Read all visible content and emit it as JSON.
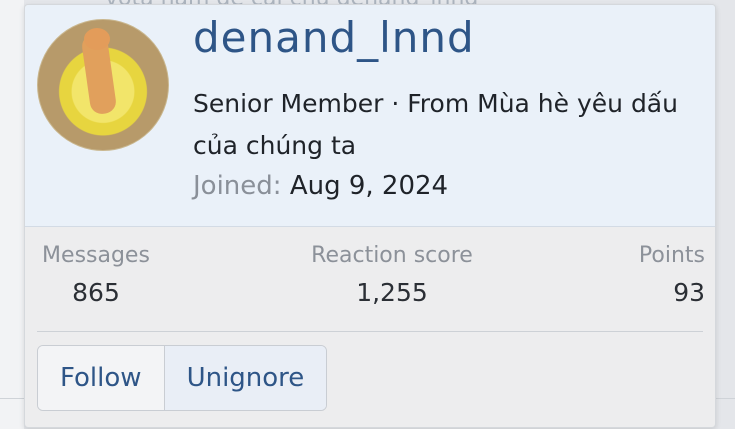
{
  "background": {
    "text": "vota ham de cai chu denand_lnnd"
  },
  "profile": {
    "username": "denand_lnnd",
    "title": "Senior Member · From Mùa hè yêu dấu của chúng ta",
    "joined_label": "Joined:",
    "joined_date": "Aug 9, 2024",
    "avatar_icon": "cat-avatar-icon"
  },
  "stats": {
    "messages_label": "Messages",
    "messages_value": "865",
    "reaction_label": "Reaction score",
    "reaction_value": "1,255",
    "points_label": "Points",
    "points_value": "93"
  },
  "actions": {
    "follow_label": "Follow",
    "unignore_label": "Unignore"
  },
  "colors": {
    "accent": "#2e5587",
    "header_bg": "#eaf1f9",
    "card_bg": "#ededee"
  }
}
